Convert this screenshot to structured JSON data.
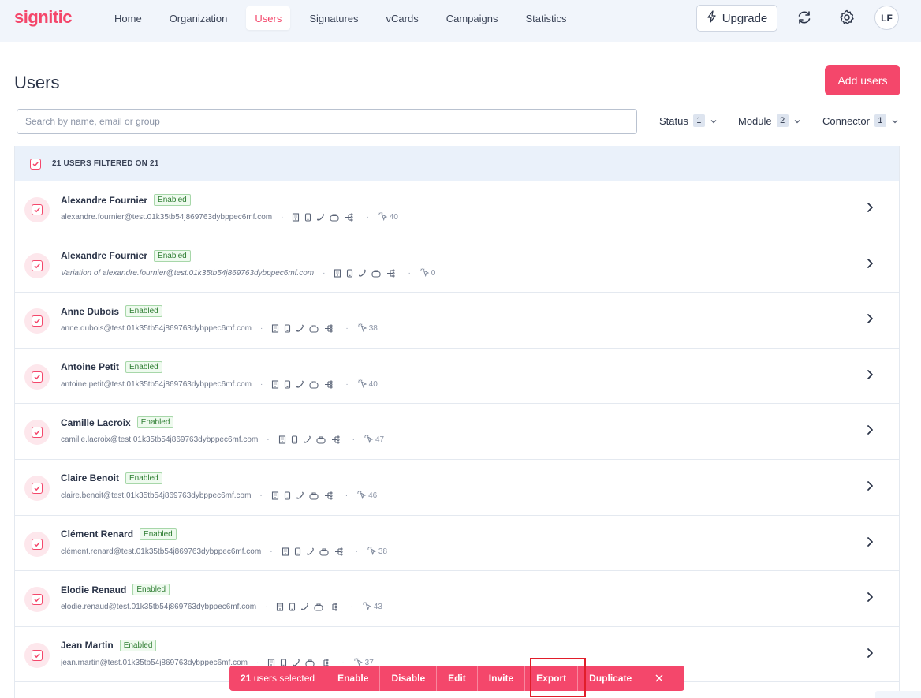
{
  "app": {
    "logo": "signitic"
  },
  "nav": {
    "items": [
      {
        "label": "Home",
        "active": false
      },
      {
        "label": "Organization",
        "active": false
      },
      {
        "label": "Users",
        "active": true
      },
      {
        "label": "Signatures",
        "active": false
      },
      {
        "label": "vCards",
        "active": false
      },
      {
        "label": "Campaigns",
        "active": false
      },
      {
        "label": "Statistics",
        "active": false
      }
    ],
    "upgrade_label": "Upgrade",
    "avatar_initials": "LF"
  },
  "page": {
    "title": "Users",
    "add_button": "Add users",
    "search_placeholder": "Search by name, email or group",
    "filters": [
      {
        "label": "Status",
        "count": "1"
      },
      {
        "label": "Module",
        "count": "2"
      },
      {
        "label": "Connector",
        "count": "1"
      }
    ],
    "table_header": "21 USERS FILTERED ON 21"
  },
  "users": [
    {
      "name": "Alexandre Fournier",
      "status": "Enabled",
      "email": "alexandre.fournier@test.01k35tb54j869763dybppec6mf.com",
      "variation": false,
      "clicks": "40"
    },
    {
      "name": "Alexandre Fournier",
      "status": "Enabled",
      "email": "Variation of alexandre.fournier@test.01k35tb54j869763dybppec6mf.com",
      "variation": true,
      "clicks": "0"
    },
    {
      "name": "Anne Dubois",
      "status": "Enabled",
      "email": "anne.dubois@test.01k35tb54j869763dybppec6mf.com",
      "variation": false,
      "clicks": "38"
    },
    {
      "name": "Antoine Petit",
      "status": "Enabled",
      "email": "antoine.petit@test.01k35tb54j869763dybppec6mf.com",
      "variation": false,
      "clicks": "40"
    },
    {
      "name": "Camille Lacroix",
      "status": "Enabled",
      "email": "camille.lacroix@test.01k35tb54j869763dybppec6mf.com",
      "variation": false,
      "clicks": "47"
    },
    {
      "name": "Claire Benoit",
      "status": "Enabled",
      "email": "claire.benoit@test.01k35tb54j869763dybppec6mf.com",
      "variation": false,
      "clicks": "46"
    },
    {
      "name": "Clément Renard",
      "status": "Enabled",
      "email": "clément.renard@test.01k35tb54j869763dybppec6mf.com",
      "variation": false,
      "clicks": "38"
    },
    {
      "name": "Elodie Renaud",
      "status": "Enabled",
      "email": "elodie.renaud@test.01k35tb54j869763dybppec6mf.com",
      "variation": false,
      "clicks": "43"
    },
    {
      "name": "Jean Martin",
      "status": "Enabled",
      "email": "jean.martin@test.01k35tb54j869763dybppec6mf.com",
      "variation": false,
      "clicks": "37"
    }
  ],
  "bulk_bar": {
    "selected_count": "21",
    "selected_suffix": " users selected",
    "actions": [
      "Enable",
      "Disable",
      "Edit",
      "Invite",
      "Export",
      "Duplicate"
    ],
    "highlighted_action": "Export"
  },
  "colors": {
    "brand": "#f4476b",
    "nav_bg": "#f1f5fb",
    "badge_green": "#2e7d32"
  }
}
